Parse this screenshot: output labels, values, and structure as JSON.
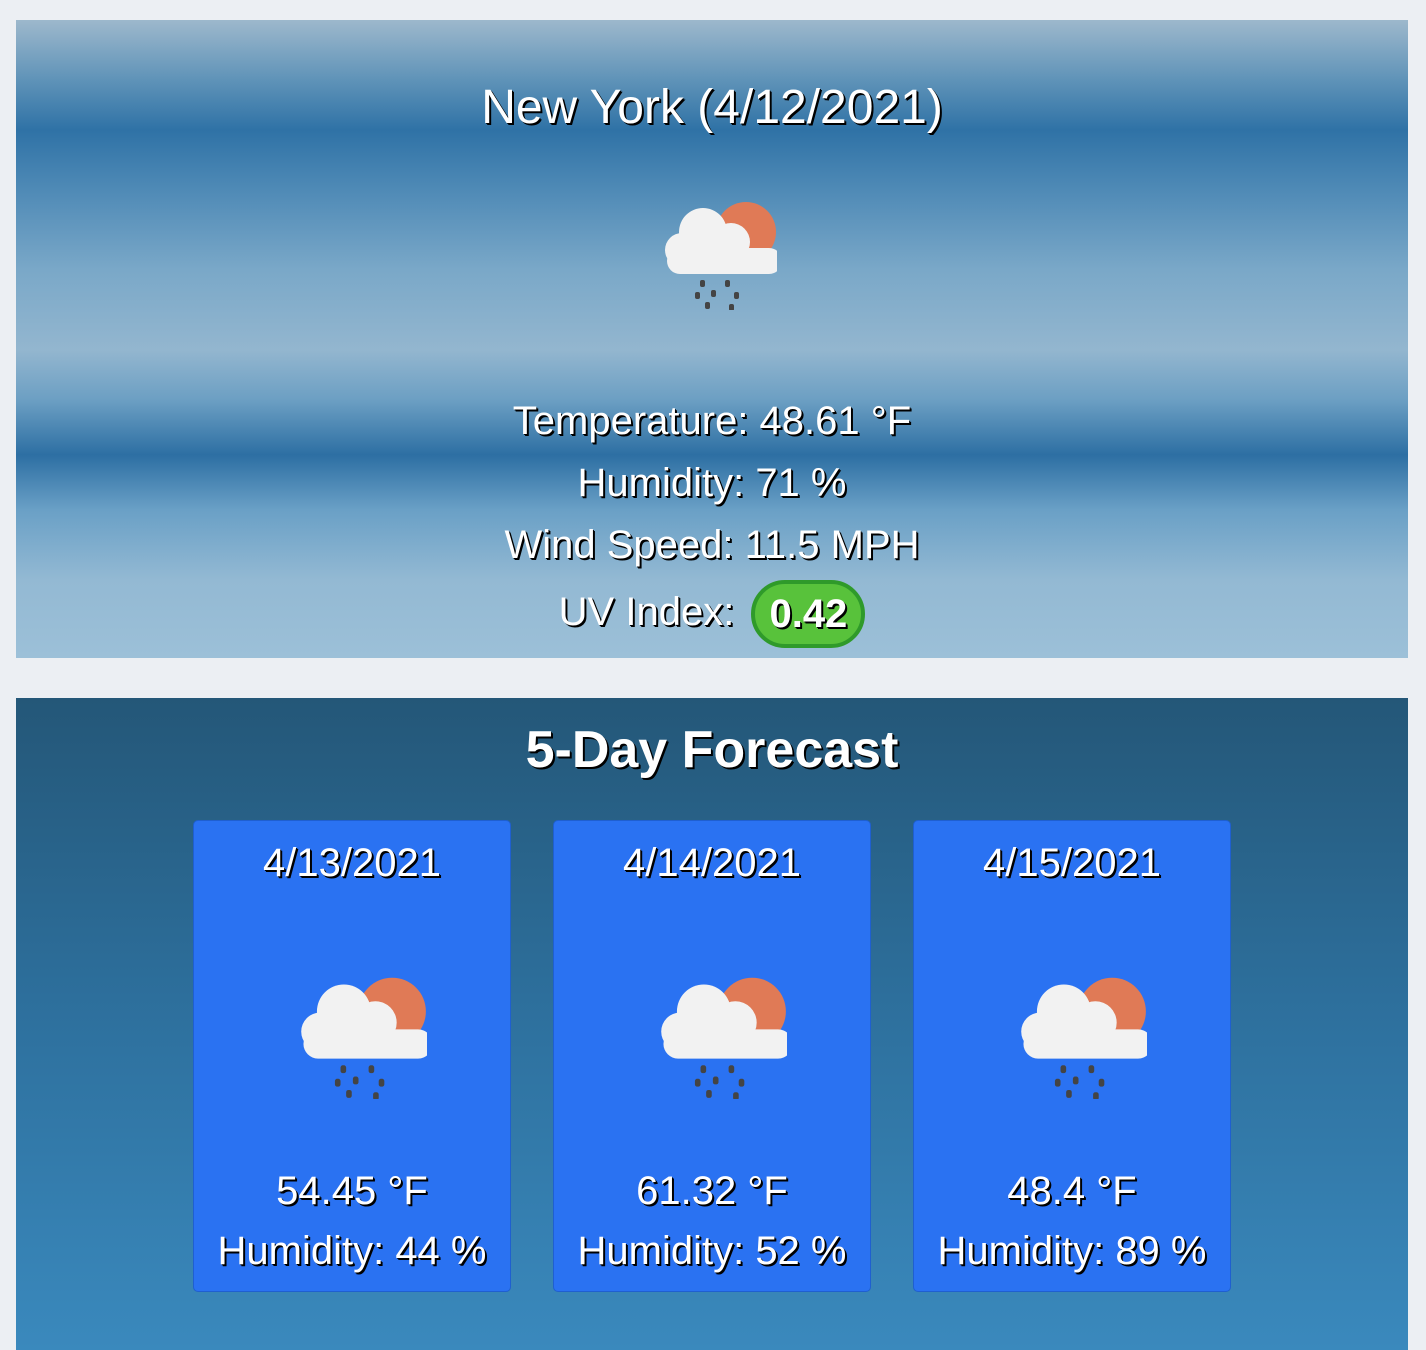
{
  "current": {
    "title": "New York (4/12/2021)",
    "icon": "cloud-sun-rain-icon",
    "temperature": "Temperature: 48.61 °F",
    "humidity": "Humidity: 71 %",
    "wind": "Wind Speed: 11.5 MPH",
    "uv_label": "UV Index:",
    "uv_value": "0.42",
    "uv_color": "#58c23b"
  },
  "forecast": {
    "title": "5-Day Forecast",
    "days": [
      {
        "date": "4/13/2021",
        "icon": "cloud-sun-rain-icon",
        "temp": "54.45 °F",
        "humidity": "Humidity: 44 %"
      },
      {
        "date": "4/14/2021",
        "icon": "cloud-sun-rain-icon",
        "temp": "61.32 °F",
        "humidity": "Humidity: 52 %"
      },
      {
        "date": "4/15/2021",
        "icon": "cloud-sun-rain-icon",
        "temp": "48.4 °F",
        "humidity": "Humidity: 89 %"
      }
    ]
  }
}
